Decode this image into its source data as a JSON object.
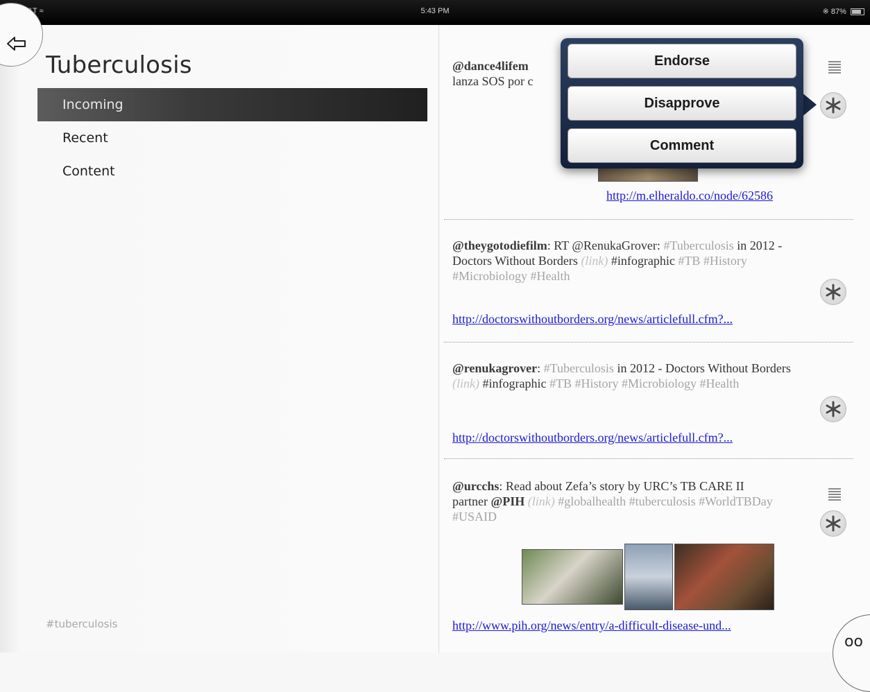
{
  "status_bar": {
    "carrier": "AT&T",
    "time": "5:43 PM",
    "battery": "87%"
  },
  "sidebar": {
    "title": "Tuberculosis",
    "items": [
      {
        "label": "Incoming",
        "active": true
      },
      {
        "label": "Recent",
        "active": false
      },
      {
        "label": "Content",
        "active": false
      }
    ],
    "footer_hashtag": "#tuberculosis"
  },
  "feed": {
    "posts": [
      {
        "user": "@dance4lifem",
        "text": "lanza SOS por c",
        "link": "http://m.elheraldo.co/node/62586"
      },
      {
        "user": "@theygotodiefilm",
        "text_a": ": RT @RenukaGrover: ",
        "tag1": "#Tuberculosis",
        "text_b": " in 2012 - Doctors Without Borders ",
        "link_word": "(link)",
        "text_c": " #infographic ",
        "tags": "#TB #History #Microbiology #Health",
        "link": "http://doctorswithoutborders.org/news/articlefull.cfm?..."
      },
      {
        "user": "@renukagrover",
        "text_a": ": ",
        "tag1": "#Tuberculosis",
        "text_b": " in 2012 - Doctors Without Borders ",
        "link_word": "(link)",
        "text_c": " #infographic ",
        "tags": "#TB #History #Microbiology #Health",
        "link": "http://doctorswithoutborders.org/news/articlefull.cfm?..."
      },
      {
        "user": "@urcchs",
        "text_a": ": Read about Zefa’s story by URC’s TB CARE II partner ",
        "user2": "@PIH",
        "link_word": "(link)",
        "tags": "#globalhealth #tuberculosis #WorldTBDay #USAID",
        "link": "http://www.pih.org/news/entry/a-difficult-disease-und..."
      }
    ]
  },
  "popover": {
    "actions": [
      "Endorse",
      "Disapprove",
      "Comment"
    ]
  },
  "colors": {
    "active_nav": "#2a2a2a",
    "link": "#1a1ad6",
    "popover_bg": "#1a2a48"
  },
  "icons": {
    "back": "back-arrow-icon",
    "star": "asterisk-icon",
    "menu": "list-icon",
    "corner": "view-toggle-icon"
  }
}
